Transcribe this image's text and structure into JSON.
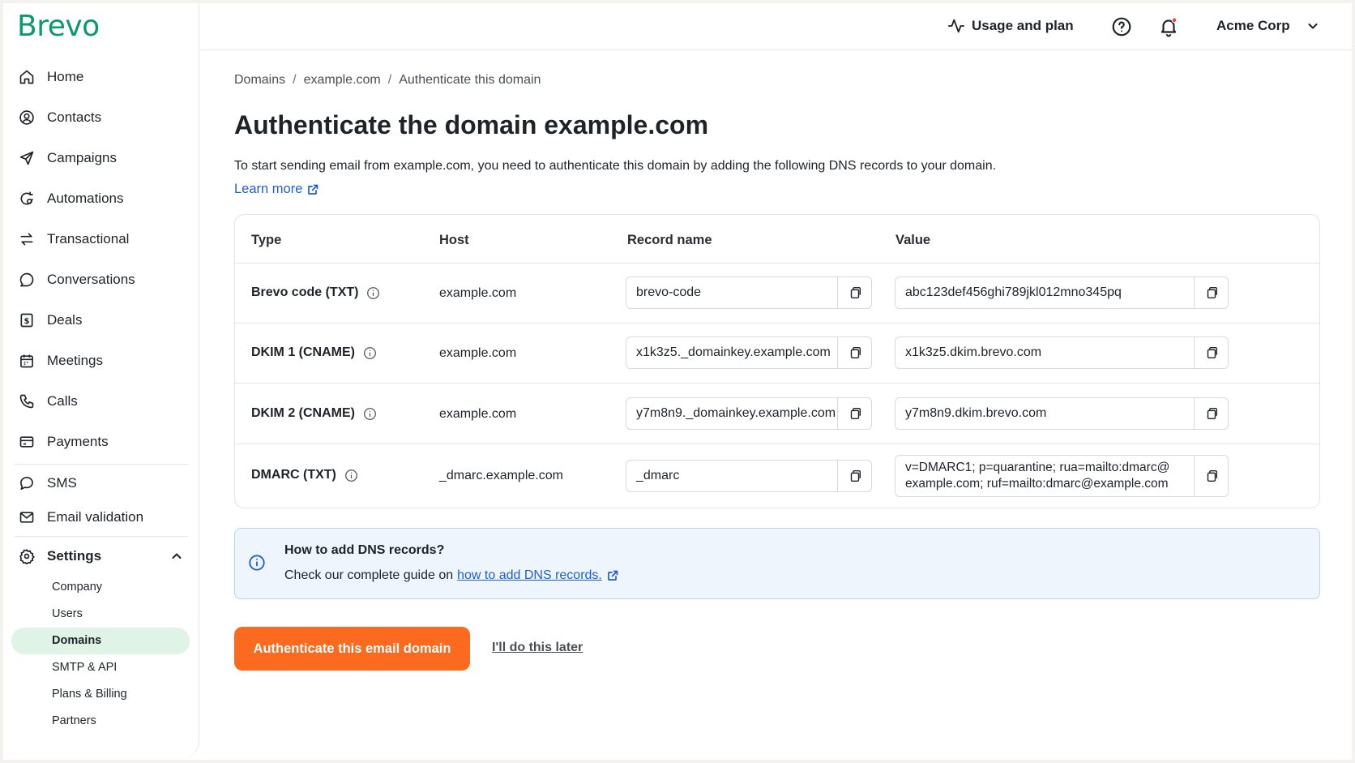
{
  "app": {
    "logo": "Brevo",
    "brand_color": "#0b996e",
    "accent_color": "#fb6a1f",
    "link_color": "#1f5ed6"
  },
  "sidebar": {
    "items": [
      {
        "label": "Home",
        "icon": "home-icon"
      },
      {
        "label": "Contacts",
        "icon": "contacts-icon"
      },
      {
        "label": "Campaigns",
        "icon": "send-icon"
      },
      {
        "label": "Automations",
        "icon": "automation-icon"
      },
      {
        "label": "Transactional",
        "icon": "transfer-icon"
      },
      {
        "label": "Conversations",
        "icon": "chat-icon"
      },
      {
        "label": "Deals",
        "icon": "dollar-icon"
      },
      {
        "label": "Meetings",
        "icon": "calendar-icon"
      },
      {
        "label": "Calls",
        "icon": "phone-icon"
      },
      {
        "label": "Payments",
        "icon": "card-icon"
      },
      {
        "label": "SMS",
        "icon": "sms-icon"
      },
      {
        "label": "Email validation",
        "icon": "mail-icon"
      }
    ],
    "settings": {
      "label": "Settings",
      "icon": "gear-icon",
      "expanded": true,
      "subitems": [
        "Company",
        "Users",
        "Domains",
        "SMTP & API",
        "Plans & Billing",
        "Partners"
      ],
      "active": "Domains"
    }
  },
  "header": {
    "usage": "Usage and plan",
    "help_icon": "help-icon",
    "bell_icon": "bell-icon",
    "account": "Acme Corp"
  },
  "breadcrumb": [
    "Domains",
    "example.com",
    "Authenticate this domain"
  ],
  "page": {
    "title": "Authenticate the domain example.com",
    "intro": "To start sending email from example.com, you need to authenticate this domain by adding the following DNS records to your domain.",
    "learn_more": "Learn more"
  },
  "table": {
    "headers": {
      "type": "Type",
      "host": "Host",
      "record_name": "Record name",
      "value": "Value"
    },
    "rows": [
      {
        "type": "Brevo code (TXT)",
        "host": "example.com",
        "record_name": "brevo-code",
        "value": "abc123def456ghi789jkl012mno345pq"
      },
      {
        "type": "DKIM 1 (CNAME)",
        "host": "example.com",
        "record_name": "x1k3z5._domainkey.example.com",
        "value": "x1k3z5.dkim.brevo.com"
      },
      {
        "type": "DKIM 2 (CNAME)",
        "host": "example.com",
        "record_name": "y7m8n9._domainkey.example.com",
        "value": "y7m8n9.dkim.brevo.com"
      },
      {
        "type": "DMARC (TXT)",
        "host": "_dmarc.example.com",
        "record_name": "_dmarc",
        "value": "v=DMARC1; p=quarantine; rua=mailto:dmarc@ example.com; ruf=mailto:dmarc@example.com"
      }
    ]
  },
  "info": {
    "title": "How to add DNS records?",
    "text": "Check our complete guide on",
    "link": "how to add DNS records."
  },
  "actions": {
    "primary": "Authenticate this email domain",
    "secondary": "I'll do this later"
  }
}
